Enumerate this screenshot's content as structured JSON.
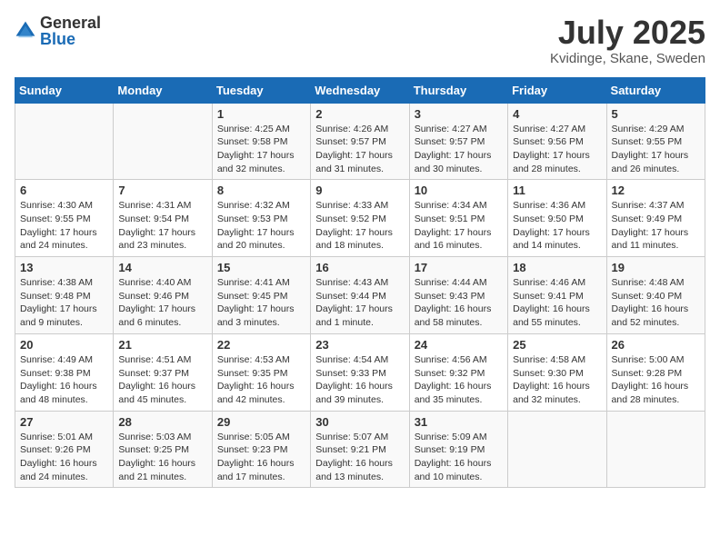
{
  "header": {
    "logo_general": "General",
    "logo_blue": "Blue",
    "month_year": "July 2025",
    "location": "Kvidinge, Skane, Sweden"
  },
  "days_of_week": [
    "Sunday",
    "Monday",
    "Tuesday",
    "Wednesday",
    "Thursday",
    "Friday",
    "Saturday"
  ],
  "weeks": [
    [
      {
        "day": "",
        "info": ""
      },
      {
        "day": "",
        "info": ""
      },
      {
        "day": "1",
        "info": "Sunrise: 4:25 AM\nSunset: 9:58 PM\nDaylight: 17 hours and 32 minutes."
      },
      {
        "day": "2",
        "info": "Sunrise: 4:26 AM\nSunset: 9:57 PM\nDaylight: 17 hours and 31 minutes."
      },
      {
        "day": "3",
        "info": "Sunrise: 4:27 AM\nSunset: 9:57 PM\nDaylight: 17 hours and 30 minutes."
      },
      {
        "day": "4",
        "info": "Sunrise: 4:27 AM\nSunset: 9:56 PM\nDaylight: 17 hours and 28 minutes."
      },
      {
        "day": "5",
        "info": "Sunrise: 4:29 AM\nSunset: 9:55 PM\nDaylight: 17 hours and 26 minutes."
      }
    ],
    [
      {
        "day": "6",
        "info": "Sunrise: 4:30 AM\nSunset: 9:55 PM\nDaylight: 17 hours and 24 minutes."
      },
      {
        "day": "7",
        "info": "Sunrise: 4:31 AM\nSunset: 9:54 PM\nDaylight: 17 hours and 23 minutes."
      },
      {
        "day": "8",
        "info": "Sunrise: 4:32 AM\nSunset: 9:53 PM\nDaylight: 17 hours and 20 minutes."
      },
      {
        "day": "9",
        "info": "Sunrise: 4:33 AM\nSunset: 9:52 PM\nDaylight: 17 hours and 18 minutes."
      },
      {
        "day": "10",
        "info": "Sunrise: 4:34 AM\nSunset: 9:51 PM\nDaylight: 17 hours and 16 minutes."
      },
      {
        "day": "11",
        "info": "Sunrise: 4:36 AM\nSunset: 9:50 PM\nDaylight: 17 hours and 14 minutes."
      },
      {
        "day": "12",
        "info": "Sunrise: 4:37 AM\nSunset: 9:49 PM\nDaylight: 17 hours and 11 minutes."
      }
    ],
    [
      {
        "day": "13",
        "info": "Sunrise: 4:38 AM\nSunset: 9:48 PM\nDaylight: 17 hours and 9 minutes."
      },
      {
        "day": "14",
        "info": "Sunrise: 4:40 AM\nSunset: 9:46 PM\nDaylight: 17 hours and 6 minutes."
      },
      {
        "day": "15",
        "info": "Sunrise: 4:41 AM\nSunset: 9:45 PM\nDaylight: 17 hours and 3 minutes."
      },
      {
        "day": "16",
        "info": "Sunrise: 4:43 AM\nSunset: 9:44 PM\nDaylight: 17 hours and 1 minute."
      },
      {
        "day": "17",
        "info": "Sunrise: 4:44 AM\nSunset: 9:43 PM\nDaylight: 16 hours and 58 minutes."
      },
      {
        "day": "18",
        "info": "Sunrise: 4:46 AM\nSunset: 9:41 PM\nDaylight: 16 hours and 55 minutes."
      },
      {
        "day": "19",
        "info": "Sunrise: 4:48 AM\nSunset: 9:40 PM\nDaylight: 16 hours and 52 minutes."
      }
    ],
    [
      {
        "day": "20",
        "info": "Sunrise: 4:49 AM\nSunset: 9:38 PM\nDaylight: 16 hours and 48 minutes."
      },
      {
        "day": "21",
        "info": "Sunrise: 4:51 AM\nSunset: 9:37 PM\nDaylight: 16 hours and 45 minutes."
      },
      {
        "day": "22",
        "info": "Sunrise: 4:53 AM\nSunset: 9:35 PM\nDaylight: 16 hours and 42 minutes."
      },
      {
        "day": "23",
        "info": "Sunrise: 4:54 AM\nSunset: 9:33 PM\nDaylight: 16 hours and 39 minutes."
      },
      {
        "day": "24",
        "info": "Sunrise: 4:56 AM\nSunset: 9:32 PM\nDaylight: 16 hours and 35 minutes."
      },
      {
        "day": "25",
        "info": "Sunrise: 4:58 AM\nSunset: 9:30 PM\nDaylight: 16 hours and 32 minutes."
      },
      {
        "day": "26",
        "info": "Sunrise: 5:00 AM\nSunset: 9:28 PM\nDaylight: 16 hours and 28 minutes."
      }
    ],
    [
      {
        "day": "27",
        "info": "Sunrise: 5:01 AM\nSunset: 9:26 PM\nDaylight: 16 hours and 24 minutes."
      },
      {
        "day": "28",
        "info": "Sunrise: 5:03 AM\nSunset: 9:25 PM\nDaylight: 16 hours and 21 minutes."
      },
      {
        "day": "29",
        "info": "Sunrise: 5:05 AM\nSunset: 9:23 PM\nDaylight: 16 hours and 17 minutes."
      },
      {
        "day": "30",
        "info": "Sunrise: 5:07 AM\nSunset: 9:21 PM\nDaylight: 16 hours and 13 minutes."
      },
      {
        "day": "31",
        "info": "Sunrise: 5:09 AM\nSunset: 9:19 PM\nDaylight: 16 hours and 10 minutes."
      },
      {
        "day": "",
        "info": ""
      },
      {
        "day": "",
        "info": ""
      }
    ]
  ]
}
